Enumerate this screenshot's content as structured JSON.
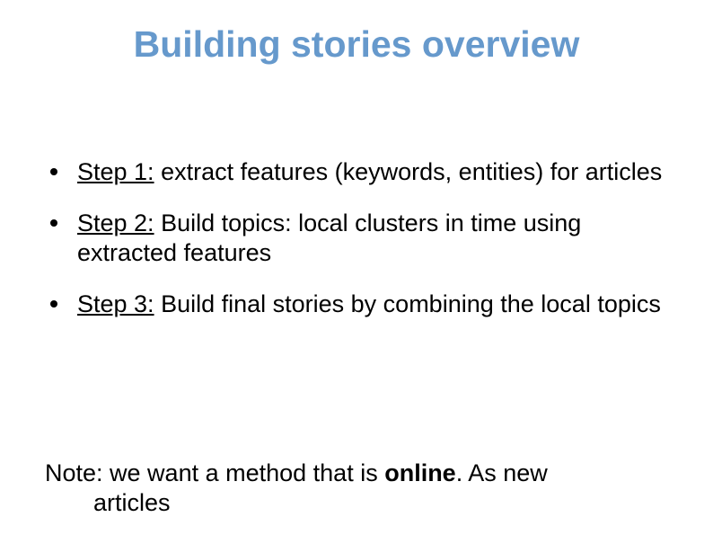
{
  "title": "Building stories overview",
  "bullets": [
    {
      "step": "Step 1:",
      "text": " extract features (keywords, entities) for articles"
    },
    {
      "step": "Step 2:",
      "text": " Build topics: local clusters in time using extracted features"
    },
    {
      "step": "Step 3:",
      "text": " Build final stories by combining the local topics"
    }
  ],
  "note": {
    "prefix": "Note: we want a method that is ",
    "emphasis": "online",
    "suffix": ". As new",
    "line2": "articles"
  }
}
